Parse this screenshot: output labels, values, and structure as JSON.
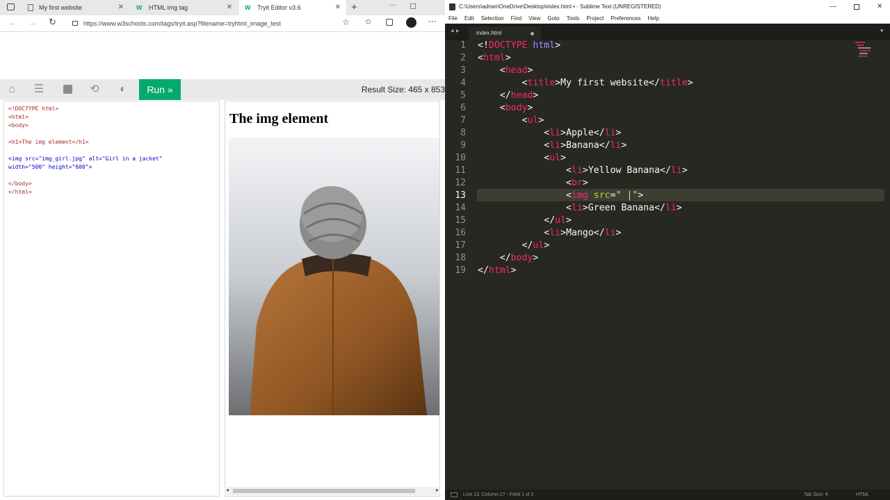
{
  "browser": {
    "tabs": [
      {
        "title": "My first website"
      },
      {
        "title": "HTML img tag"
      },
      {
        "title": "Tryit Editor v3.6"
      }
    ],
    "url": "https://www.w3schools.com/tags/tryit.asp?filename=tryhtml_image_test",
    "run_label": "Run »",
    "result_size": "Result Size: 465 x 853",
    "code_lines": [
      "<!DOCTYPE html>",
      "<html>",
      "<body>",
      "",
      "<h1>The img element</h1>",
      "",
      "<img src=\"img_girl.jpg\" alt=\"Girl in a jacket\"",
      "width=\"500\" height=\"600\">",
      "",
      "</body>",
      "</html>"
    ],
    "result_heading": "The img element"
  },
  "sublime": {
    "title": "C:\\Users\\adnan\\OneDrive\\Desktop\\index.html • - Sublime Text (UNREGISTERED)",
    "menu": [
      "File",
      "Edit",
      "Selection",
      "Find",
      "View",
      "Goto",
      "Tools",
      "Project",
      "Preferences",
      "Help"
    ],
    "tab": "index.html",
    "line_numbers": [
      "1",
      "2",
      "3",
      "4",
      "5",
      "6",
      "7",
      "8",
      "9",
      "10",
      "11",
      "12",
      "13",
      "14",
      "15",
      "16",
      "17",
      "18",
      "19"
    ],
    "status_left": "Line 13, Column 27 - Field 1 of 2",
    "status_tab": "Tab Size: 4",
    "status_syntax": "HTML"
  },
  "colors": {
    "run_green": "#04aa6d",
    "monokai_bg": "#272822",
    "monokai_pink": "#f92672",
    "monokai_green": "#a6e22e"
  }
}
